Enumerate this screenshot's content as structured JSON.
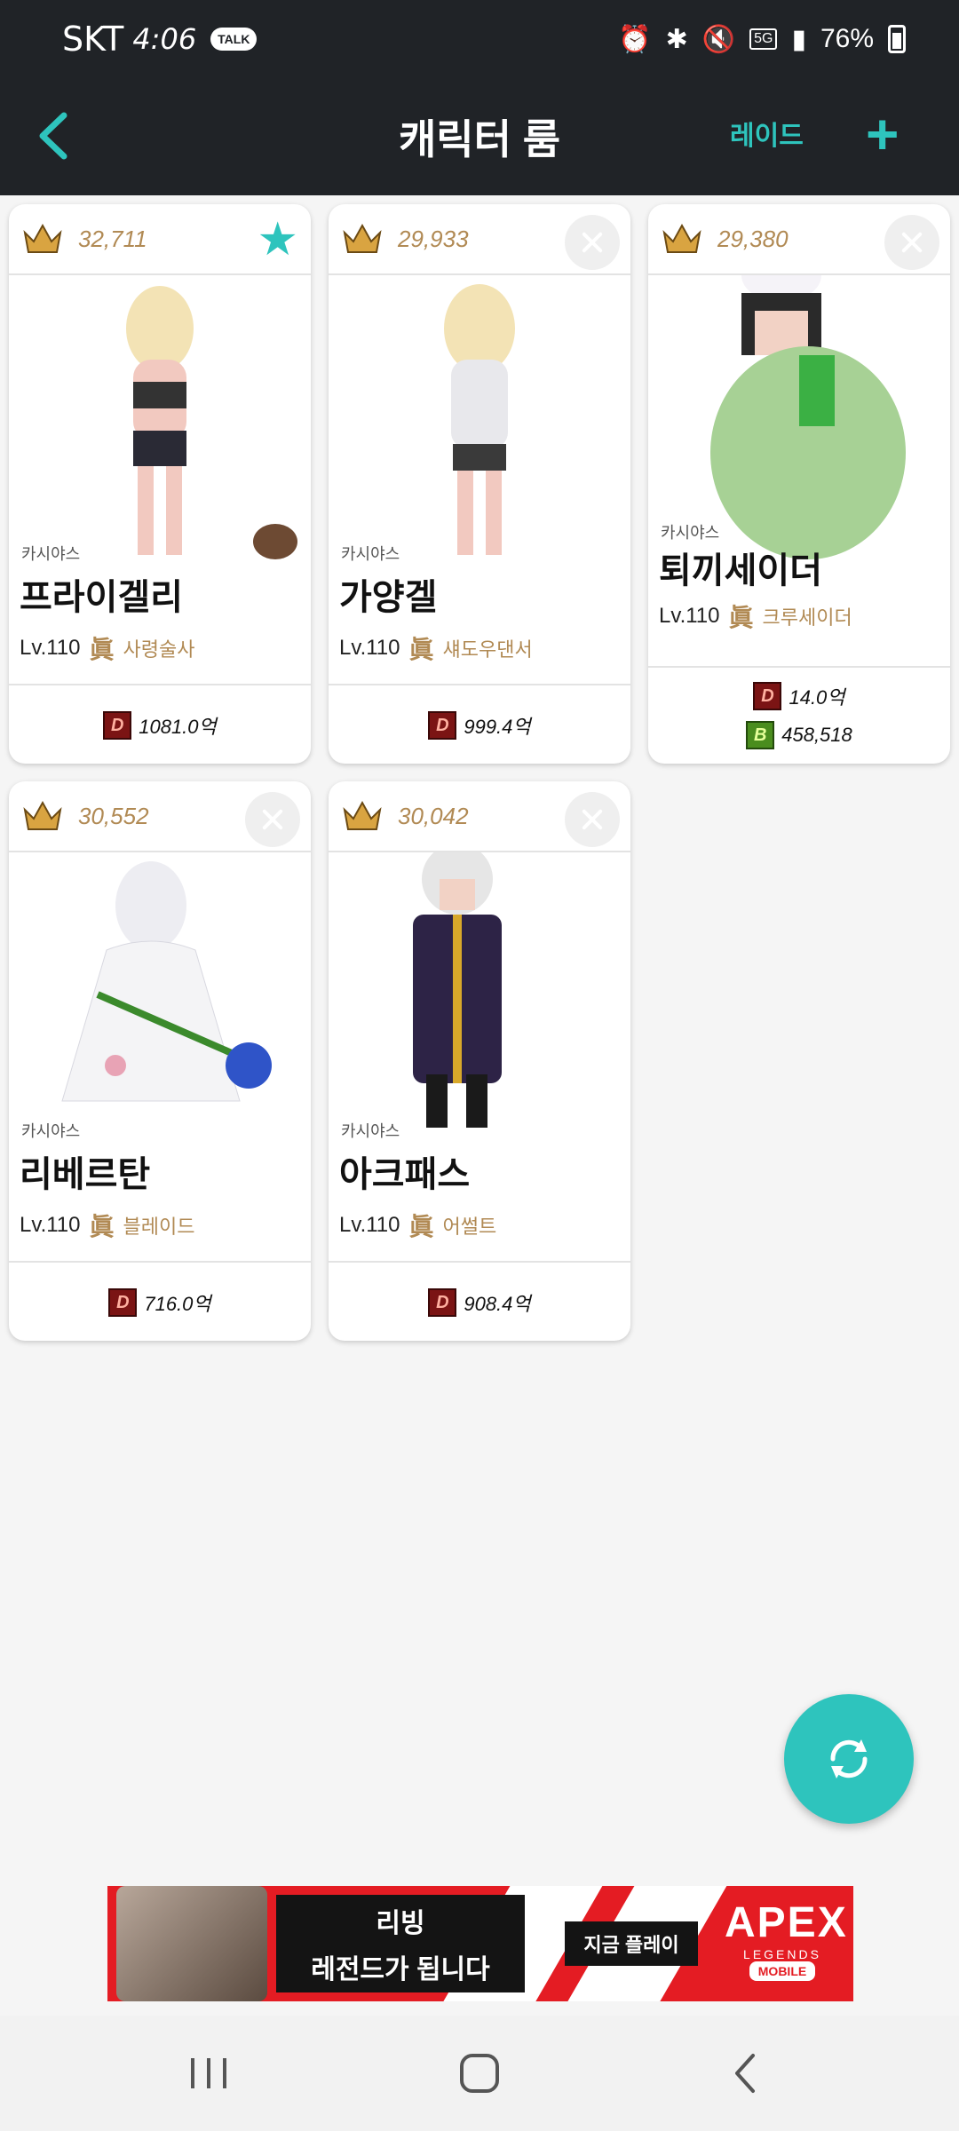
{
  "status_bar": {
    "carrier": "SKT",
    "time": "4:06",
    "talk_badge": "TALK",
    "network": "5G",
    "battery": "76%"
  },
  "header": {
    "title": "캐릭터 룸",
    "raid_label": "레이드",
    "add_label": "+",
    "back_icon": "chevron-left-icon"
  },
  "cards": [
    {
      "score": "32,711",
      "favorite": true,
      "server": "카시야스",
      "name": "프라이겔리",
      "level": "Lv.110",
      "true_mark": "眞",
      "job": "사령술사",
      "money": [
        {
          "badge": "D",
          "value": "1081.0억"
        }
      ]
    },
    {
      "score": "29,933",
      "favorite": false,
      "server": "카시야스",
      "name": "가양겔",
      "level": "Lv.110",
      "true_mark": "眞",
      "job": "섀도우댄서",
      "money": [
        {
          "badge": "D",
          "value": "999.4억"
        }
      ]
    },
    {
      "score": "29,380",
      "favorite": false,
      "server": "카시야스",
      "name": "퇴끼세이더",
      "level": "Lv.110",
      "true_mark": "眞",
      "job": "크루세이더",
      "money": [
        {
          "badge": "D",
          "value": "14.0억"
        },
        {
          "badge": "B",
          "value": "458,518"
        }
      ]
    },
    {
      "score": "30,552",
      "favorite": false,
      "server": "카시야스",
      "name": "리베르탄",
      "level": "Lv.110",
      "true_mark": "眞",
      "job": "블레이드",
      "money": [
        {
          "badge": "D",
          "value": "716.0억"
        }
      ]
    },
    {
      "score": "30,042",
      "favorite": false,
      "server": "카시야스",
      "name": "아크패스",
      "level": "Lv.110",
      "true_mark": "眞",
      "job": "어썰트",
      "money": [
        {
          "badge": "D",
          "value": "908.4억"
        }
      ]
    }
  ],
  "fab": {
    "icon": "refresh-icon"
  },
  "ad": {
    "line1": "리빙",
    "line2": "레전드가 됩니다",
    "play_button": "지금 플레이",
    "logo_title": "APEX",
    "logo_sub": "LEGENDS",
    "logo_mobile": "MOBILE"
  },
  "colors": {
    "accent": "#2ec4bd",
    "header_bg": "#202327",
    "gold": "#b18a54"
  }
}
